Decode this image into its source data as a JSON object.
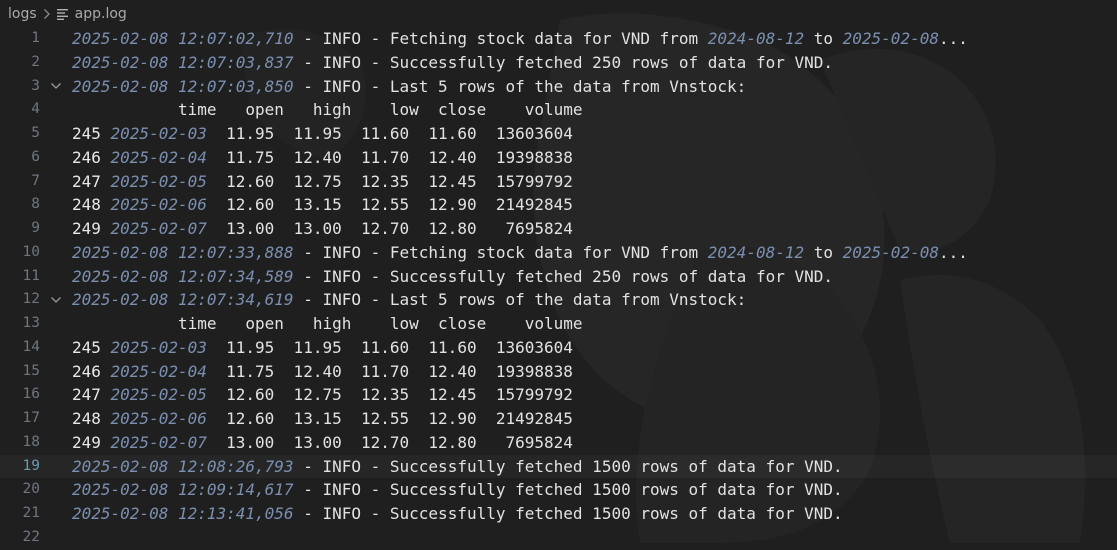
{
  "breadcrumb": {
    "folder": "logs",
    "file": "app.log"
  },
  "lines": [
    {
      "no": "1",
      "segs": [
        {
          "t": "2025-02-08 12:07:02,710",
          "c": "ts"
        },
        {
          "t": " - INFO - Fetching stock data for VND from ",
          "c": "txt"
        },
        {
          "t": "2024-08-12",
          "c": "dt"
        },
        {
          "t": " to ",
          "c": "txt"
        },
        {
          "t": "2025-02-08",
          "c": "dt"
        },
        {
          "t": "...",
          "c": "txt"
        }
      ]
    },
    {
      "no": "2",
      "segs": [
        {
          "t": "2025-02-08 12:07:03,837",
          "c": "ts"
        },
        {
          "t": " - INFO - Successfully fetched 250 rows of data for VND.",
          "c": "txt"
        }
      ]
    },
    {
      "no": "3",
      "fold": true,
      "segs": [
        {
          "t": "2025-02-08 12:07:03,850",
          "c": "ts"
        },
        {
          "t": " - INFO - Last 5 rows of the data from Vnstock:",
          "c": "txt"
        }
      ]
    },
    {
      "no": "4",
      "segs": [
        {
          "t": "           time   open   high    low  close    volume",
          "c": "txt"
        }
      ]
    },
    {
      "no": "5",
      "segs": [
        {
          "t": "245 ",
          "c": "idx"
        },
        {
          "t": "2025-02-03",
          "c": "dt"
        },
        {
          "t": "  11.95  11.95  11.60  11.60  13603604",
          "c": "txt"
        }
      ]
    },
    {
      "no": "6",
      "segs": [
        {
          "t": "246 ",
          "c": "idx"
        },
        {
          "t": "2025-02-04",
          "c": "dt"
        },
        {
          "t": "  11.75  12.40  11.70  12.40  19398838",
          "c": "txt"
        }
      ]
    },
    {
      "no": "7",
      "segs": [
        {
          "t": "247 ",
          "c": "idx"
        },
        {
          "t": "2025-02-05",
          "c": "dt"
        },
        {
          "t": "  12.60  12.75  12.35  12.45  15799792",
          "c": "txt"
        }
      ]
    },
    {
      "no": "8",
      "segs": [
        {
          "t": "248 ",
          "c": "idx"
        },
        {
          "t": "2025-02-06",
          "c": "dt"
        },
        {
          "t": "  12.60  13.15  12.55  12.90  21492845",
          "c": "txt"
        }
      ]
    },
    {
      "no": "9",
      "segs": [
        {
          "t": "249 ",
          "c": "idx"
        },
        {
          "t": "2025-02-07",
          "c": "dt"
        },
        {
          "t": "  13.00  13.00  12.70  12.80   7695824",
          "c": "txt"
        }
      ]
    },
    {
      "no": "10",
      "segs": [
        {
          "t": "2025-02-08 12:07:33,888",
          "c": "ts"
        },
        {
          "t": " - INFO - Fetching stock data for VND from ",
          "c": "txt"
        },
        {
          "t": "2024-08-12",
          "c": "dt"
        },
        {
          "t": " to ",
          "c": "txt"
        },
        {
          "t": "2025-02-08",
          "c": "dt"
        },
        {
          "t": "...",
          "c": "txt"
        }
      ]
    },
    {
      "no": "11",
      "segs": [
        {
          "t": "2025-02-08 12:07:34,589",
          "c": "ts"
        },
        {
          "t": " - INFO - Successfully fetched 250 rows of data for VND.",
          "c": "txt"
        }
      ]
    },
    {
      "no": "12",
      "fold": true,
      "segs": [
        {
          "t": "2025-02-08 12:07:34,619",
          "c": "ts"
        },
        {
          "t": " - INFO - Last 5 rows of the data from Vnstock:",
          "c": "txt"
        }
      ]
    },
    {
      "no": "13",
      "segs": [
        {
          "t": "           time   open   high    low  close    volume",
          "c": "txt"
        }
      ]
    },
    {
      "no": "14",
      "segs": [
        {
          "t": "245 ",
          "c": "idx"
        },
        {
          "t": "2025-02-03",
          "c": "dt"
        },
        {
          "t": "  11.95  11.95  11.60  11.60  13603604",
          "c": "txt"
        }
      ]
    },
    {
      "no": "15",
      "segs": [
        {
          "t": "246 ",
          "c": "idx"
        },
        {
          "t": "2025-02-04",
          "c": "dt"
        },
        {
          "t": "  11.75  12.40  11.70  12.40  19398838",
          "c": "txt"
        }
      ]
    },
    {
      "no": "16",
      "segs": [
        {
          "t": "247 ",
          "c": "idx"
        },
        {
          "t": "2025-02-05",
          "c": "dt"
        },
        {
          "t": "  12.60  12.75  12.35  12.45  15799792",
          "c": "txt"
        }
      ]
    },
    {
      "no": "17",
      "segs": [
        {
          "t": "248 ",
          "c": "idx"
        },
        {
          "t": "2025-02-06",
          "c": "dt"
        },
        {
          "t": "  12.60  13.15  12.55  12.90  21492845",
          "c": "txt"
        }
      ]
    },
    {
      "no": "18",
      "segs": [
        {
          "t": "249 ",
          "c": "idx"
        },
        {
          "t": "2025-02-07",
          "c": "dt"
        },
        {
          "t": "  13.00  13.00  12.70  12.80   7695824",
          "c": "txt"
        }
      ]
    },
    {
      "no": "19",
      "current": true,
      "segs": [
        {
          "t": "2025-02-08 12:08:26,793",
          "c": "ts"
        },
        {
          "t": " - INFO - Successfully fetched 1500 rows of data for VND.",
          "c": "txt"
        }
      ]
    },
    {
      "no": "20",
      "segs": [
        {
          "t": "2025-02-08 12:09:14,617",
          "c": "ts"
        },
        {
          "t": " - INFO - Successfully fetched 1500 rows of data for VND.",
          "c": "txt"
        }
      ]
    },
    {
      "no": "21",
      "segs": [
        {
          "t": "2025-02-08 12:13:41,056",
          "c": "ts"
        },
        {
          "t": " - INFO - Successfully fetched 1500 rows of data for VND.",
          "c": "txt"
        }
      ]
    },
    {
      "no": "22",
      "segs": []
    }
  ]
}
